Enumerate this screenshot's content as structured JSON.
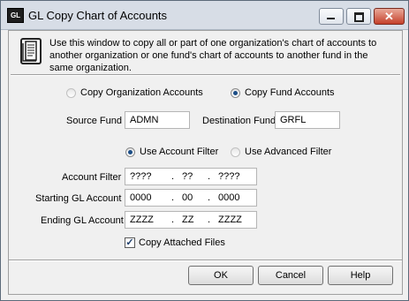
{
  "window": {
    "app_badge": "GL",
    "title": "GL Copy Chart of Accounts",
    "close_glyph": "✕"
  },
  "info": {
    "icon": "document-icon",
    "text": "Use this window to copy all or part of one organization's chart of accounts to another organization or one fund's chart of accounts to another fund in the same organization."
  },
  "copy_mode": {
    "options": [
      {
        "label": "Copy Organization Accounts",
        "selected": false
      },
      {
        "label": "Copy Fund Accounts",
        "selected": true
      }
    ]
  },
  "funds": {
    "source_label": "Source Fund",
    "source_value": "ADMN",
    "destination_label": "Destination Fund",
    "destination_value": "GRFL"
  },
  "filter_mode": {
    "options": [
      {
        "label": "Use Account Filter",
        "selected": true
      },
      {
        "label": "Use Advanced Filter",
        "selected": false
      }
    ]
  },
  "account_fields": [
    {
      "label": "Account Filter",
      "segments": [
        "????",
        ".",
        "??",
        ".",
        "????"
      ]
    },
    {
      "label": "Starting GL Account",
      "segments": [
        "0000",
        ".",
        "00",
        ".",
        "0000"
      ]
    },
    {
      "label": "Ending GL Account",
      "segments": [
        "ZZZZ",
        ".",
        "ZZ",
        ".",
        "ZZZZ"
      ]
    }
  ],
  "copy_attached": {
    "label": "Copy Attached Files",
    "checked": true,
    "mark": "✓"
  },
  "buttons": {
    "ok": "OK",
    "cancel": "Cancel",
    "help": "Help"
  }
}
